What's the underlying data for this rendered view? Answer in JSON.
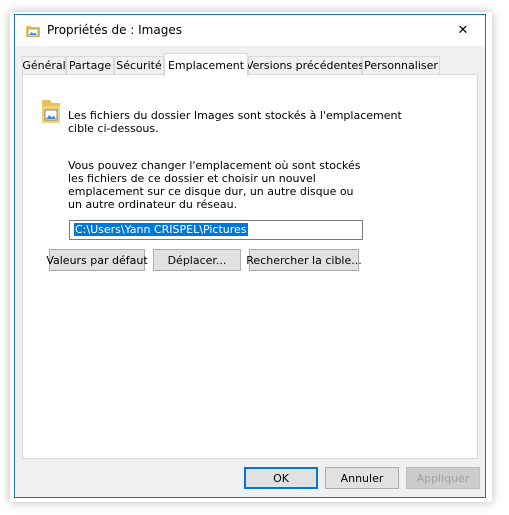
{
  "window": {
    "title": "Propriétés de : Images",
    "close_symbol": "✕"
  },
  "tabs": [
    {
      "label": "Général",
      "active": false
    },
    {
      "label": "Partage",
      "active": false
    },
    {
      "label": "Sécurité",
      "active": false
    },
    {
      "label": "Emplacement",
      "active": true
    },
    {
      "label": "Versions précédentes",
      "active": false
    },
    {
      "label": "Personnaliser",
      "active": false
    }
  ],
  "location_tab": {
    "info_text": "Les fichiers du dossier Images sont stockés à l'emplacement cible ci-dessous.",
    "description": "Vous pouvez changer l'emplacement où sont stockés les fichiers de ce dossier et choisir un nouvel emplacement sur ce disque dur, un autre disque ou un autre ordinateur du réseau.",
    "path_value": "C:\\Users\\Yann CRISPEL\\Pictures",
    "restore_default_label": "Valeurs par défaut",
    "move_label": "Déplacer...",
    "find_target_label": "Rechercher la cible..."
  },
  "footer": {
    "ok_label": "OK",
    "cancel_label": "Annuler",
    "apply_label": "Appliquer"
  },
  "icons": {
    "title_icon": "folder-pictures-icon",
    "content_icon": "folder-pictures-icon",
    "close": "close-icon"
  },
  "colors": {
    "accent": "#0078d7",
    "window_border": "#1a73b8",
    "folder": "#e8c15a"
  }
}
